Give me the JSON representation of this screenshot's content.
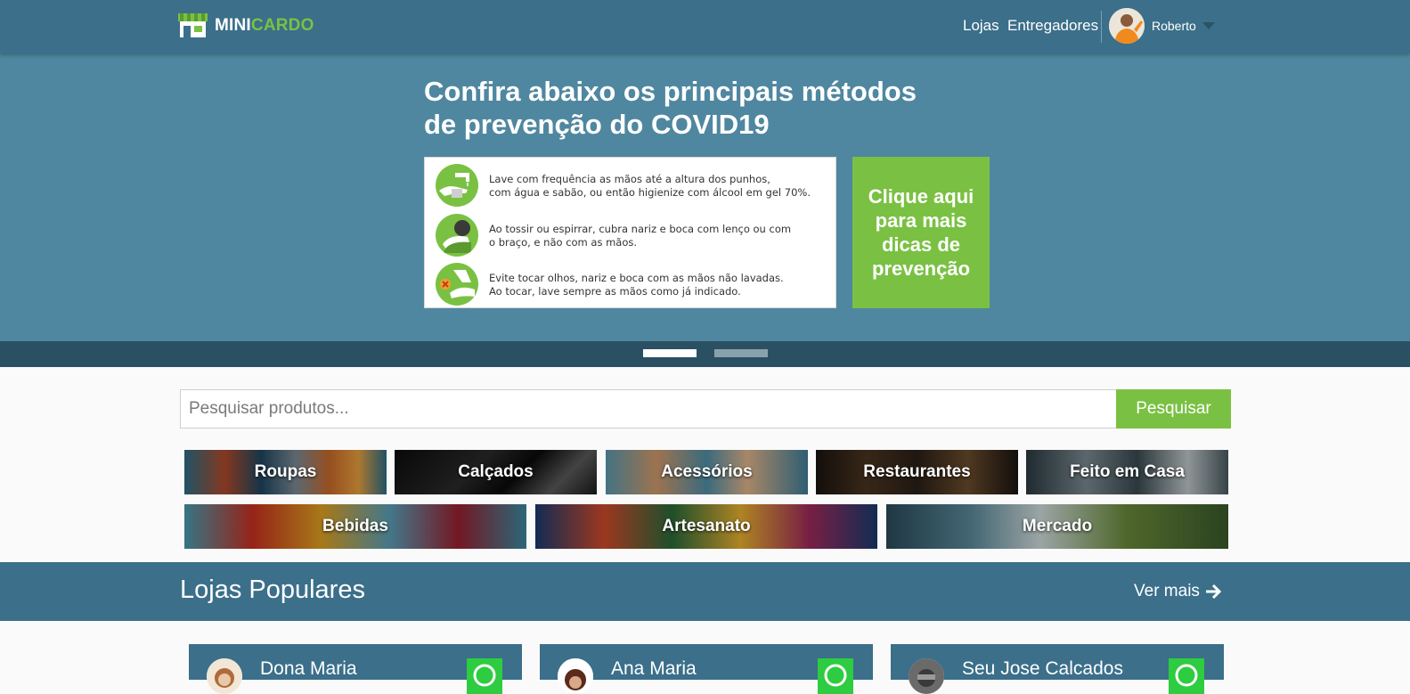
{
  "brand": {
    "part1": "MINI",
    "part2": "CARDO",
    "accent": "#7ac143",
    "primary": "#3b6f8a"
  },
  "nav": {
    "links": [
      "Lojas",
      "Entregadores"
    ],
    "user": {
      "name": "Roberto",
      "avatar_icon": "user-avatar"
    }
  },
  "hero": {
    "title_line1": "Confira abaixo os principais métodos",
    "title_line2": "de prevenção do COVID19",
    "tips": [
      {
        "icon": "hand-wash-icon",
        "line1": "Lave com frequência as mãos até a altura dos punhos,",
        "line2": "com água e sabão, ou então higienize com álcool em gel 70%."
      },
      {
        "icon": "cough-elbow-icon",
        "line1": "Ao tossir ou espirrar, cubra nariz e boca com lenço ou com",
        "line2": "o braço, e não com as mãos."
      },
      {
        "icon": "no-face-touch-icon",
        "line1": "Evite tocar olhos, nariz e boca com as mãos não lavadas.",
        "line2": "Ao tocar, lave sempre as mãos como já indicado."
      }
    ],
    "cta": "Clique aqui para mais dicas de prevenção",
    "slides": 2,
    "active_slide": 1
  },
  "search": {
    "placeholder": "Pesquisar produtos...",
    "button": "Pesquisar"
  },
  "categories_row1": [
    "Roupas",
    "Calçados",
    "Acessórios",
    "Restaurantes",
    "Feito em Casa"
  ],
  "categories_row2": [
    "Bebidas",
    "Artesanato",
    "Mercado"
  ],
  "popular": {
    "title": "Lojas Populares",
    "see_more": "Ver mais",
    "stores": [
      "Dona Maria",
      "Ana Maria",
      "Seu Jose Calcados"
    ]
  }
}
